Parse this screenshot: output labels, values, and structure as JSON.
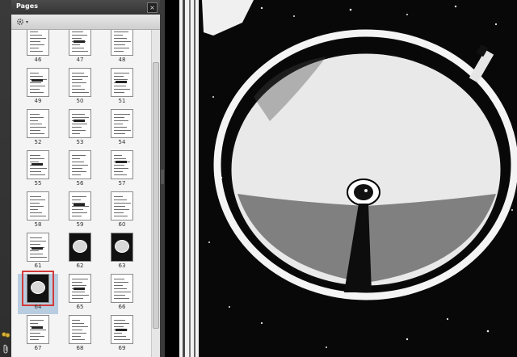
{
  "panel": {
    "title": "Pages",
    "options_label": "▾"
  },
  "thumbnails": [
    {
      "label": "46",
      "style": "text"
    },
    {
      "label": "47",
      "style": "text"
    },
    {
      "label": "48",
      "style": "text"
    },
    {
      "label": "49",
      "style": "text"
    },
    {
      "label": "50",
      "style": "text"
    },
    {
      "label": "51",
      "style": "text"
    },
    {
      "label": "52",
      "style": "text"
    },
    {
      "label": "53",
      "style": "text"
    },
    {
      "label": "54",
      "style": "text"
    },
    {
      "label": "55",
      "style": "text"
    },
    {
      "label": "56",
      "style": "text"
    },
    {
      "label": "57",
      "style": "text"
    },
    {
      "label": "58",
      "style": "text"
    },
    {
      "label": "59",
      "style": "text"
    },
    {
      "label": "60",
      "style": "text"
    },
    {
      "label": "61",
      "style": "text"
    },
    {
      "label": "62",
      "style": "photo"
    },
    {
      "label": "63",
      "style": "photo"
    },
    {
      "label": "64",
      "style": "photo",
      "selected": true
    },
    {
      "label": "65",
      "style": "text"
    },
    {
      "label": "66",
      "style": "text"
    },
    {
      "label": "67",
      "style": "text"
    },
    {
      "label": "68",
      "style": "text"
    },
    {
      "label": "69",
      "style": "text"
    }
  ],
  "colors": {
    "selection_bg": "#b9cde0",
    "selection_frame": "#d23a3a",
    "panel_bg": "#f1f1f1",
    "header_bg": "#3d3d3d"
  },
  "icons": {
    "close": "close-icon",
    "options": "gear-icon",
    "attachments": "paperclip-icon",
    "signatures": "keys-icon"
  }
}
